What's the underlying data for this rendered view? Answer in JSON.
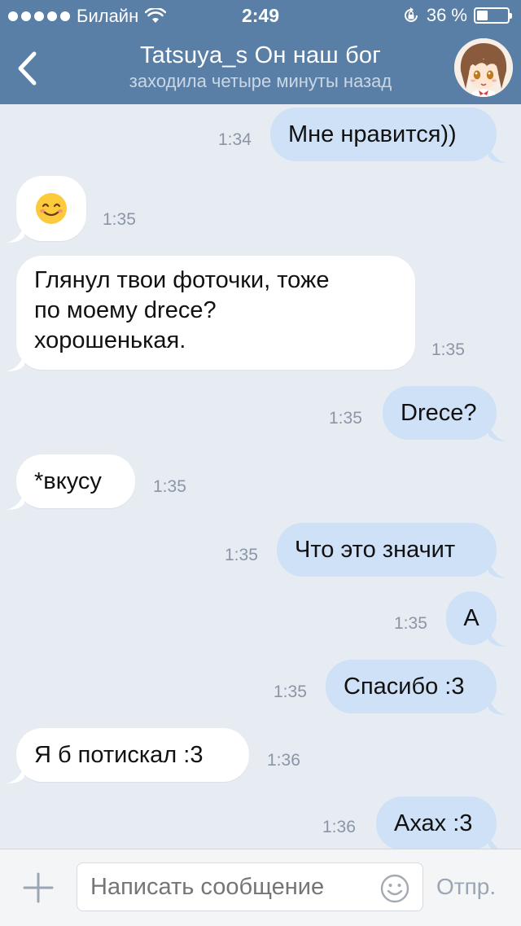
{
  "status_bar": {
    "carrier": "Билайн",
    "time": "2:49",
    "battery_text": "36 %",
    "battery_level": 0.36,
    "signal_bars": 5
  },
  "nav": {
    "title": "Tatsuya_s Он наш бог",
    "subtitle": "заходила четыре минуты назад",
    "back_icon": "chevron-left-icon",
    "avatar": "anime-avatar"
  },
  "messages": [
    {
      "dir": "out",
      "text": "Мне нравится))",
      "time": "1:34"
    },
    {
      "dir": "in",
      "text": "",
      "emoji": "smiling-face-emoji",
      "time": "1:35"
    },
    {
      "dir": "in",
      "lines": [
        "Глянул твои фоточки, тоже",
        "по моему drece?",
        "хорошенькая."
      ],
      "time": "1:35"
    },
    {
      "dir": "out",
      "text": "Drece?",
      "time": "1:35"
    },
    {
      "dir": "in",
      "text": "*вкусу",
      "time": "1:35"
    },
    {
      "dir": "out",
      "text": "Что это значит",
      "time": "1:35"
    },
    {
      "dir": "out",
      "text": "А",
      "time": "1:35"
    },
    {
      "dir": "out",
      "text": "Спасибо :3",
      "time": "1:35"
    },
    {
      "dir": "in",
      "text": "Я б потискал :3",
      "time": "1:36"
    },
    {
      "dir": "out",
      "text": "Ахах :3",
      "time": "1:36"
    }
  ],
  "composer": {
    "placeholder": "Написать сообщение",
    "send_label": "Отпр.",
    "attach_icon": "plus-icon",
    "emoji_icon": "emoji-icon"
  },
  "colors": {
    "header_bg": "#5a7fa6",
    "chat_bg": "#e6ecf2",
    "incoming_bubble": "#ffffff",
    "outgoing_bubble": "#cfe1f7",
    "timestamp": "#8a96a6"
  }
}
